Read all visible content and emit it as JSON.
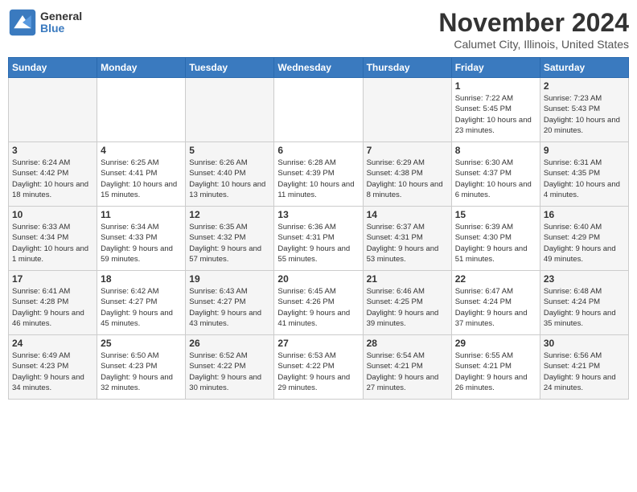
{
  "header": {
    "logo_general": "General",
    "logo_blue": "Blue",
    "month": "November 2024",
    "location": "Calumet City, Illinois, United States"
  },
  "days_of_week": [
    "Sunday",
    "Monday",
    "Tuesday",
    "Wednesday",
    "Thursday",
    "Friday",
    "Saturday"
  ],
  "weeks": [
    [
      {
        "day": "",
        "info": ""
      },
      {
        "day": "",
        "info": ""
      },
      {
        "day": "",
        "info": ""
      },
      {
        "day": "",
        "info": ""
      },
      {
        "day": "",
        "info": ""
      },
      {
        "day": "1",
        "info": "Sunrise: 7:22 AM\nSunset: 5:45 PM\nDaylight: 10 hours and 23 minutes."
      },
      {
        "day": "2",
        "info": "Sunrise: 7:23 AM\nSunset: 5:43 PM\nDaylight: 10 hours and 20 minutes."
      }
    ],
    [
      {
        "day": "3",
        "info": "Sunrise: 6:24 AM\nSunset: 4:42 PM\nDaylight: 10 hours and 18 minutes."
      },
      {
        "day": "4",
        "info": "Sunrise: 6:25 AM\nSunset: 4:41 PM\nDaylight: 10 hours and 15 minutes."
      },
      {
        "day": "5",
        "info": "Sunrise: 6:26 AM\nSunset: 4:40 PM\nDaylight: 10 hours and 13 minutes."
      },
      {
        "day": "6",
        "info": "Sunrise: 6:28 AM\nSunset: 4:39 PM\nDaylight: 10 hours and 11 minutes."
      },
      {
        "day": "7",
        "info": "Sunrise: 6:29 AM\nSunset: 4:38 PM\nDaylight: 10 hours and 8 minutes."
      },
      {
        "day": "8",
        "info": "Sunrise: 6:30 AM\nSunset: 4:37 PM\nDaylight: 10 hours and 6 minutes."
      },
      {
        "day": "9",
        "info": "Sunrise: 6:31 AM\nSunset: 4:35 PM\nDaylight: 10 hours and 4 minutes."
      }
    ],
    [
      {
        "day": "10",
        "info": "Sunrise: 6:33 AM\nSunset: 4:34 PM\nDaylight: 10 hours and 1 minute."
      },
      {
        "day": "11",
        "info": "Sunrise: 6:34 AM\nSunset: 4:33 PM\nDaylight: 9 hours and 59 minutes."
      },
      {
        "day": "12",
        "info": "Sunrise: 6:35 AM\nSunset: 4:32 PM\nDaylight: 9 hours and 57 minutes."
      },
      {
        "day": "13",
        "info": "Sunrise: 6:36 AM\nSunset: 4:31 PM\nDaylight: 9 hours and 55 minutes."
      },
      {
        "day": "14",
        "info": "Sunrise: 6:37 AM\nSunset: 4:31 PM\nDaylight: 9 hours and 53 minutes."
      },
      {
        "day": "15",
        "info": "Sunrise: 6:39 AM\nSunset: 4:30 PM\nDaylight: 9 hours and 51 minutes."
      },
      {
        "day": "16",
        "info": "Sunrise: 6:40 AM\nSunset: 4:29 PM\nDaylight: 9 hours and 49 minutes."
      }
    ],
    [
      {
        "day": "17",
        "info": "Sunrise: 6:41 AM\nSunset: 4:28 PM\nDaylight: 9 hours and 46 minutes."
      },
      {
        "day": "18",
        "info": "Sunrise: 6:42 AM\nSunset: 4:27 PM\nDaylight: 9 hours and 45 minutes."
      },
      {
        "day": "19",
        "info": "Sunrise: 6:43 AM\nSunset: 4:27 PM\nDaylight: 9 hours and 43 minutes."
      },
      {
        "day": "20",
        "info": "Sunrise: 6:45 AM\nSunset: 4:26 PM\nDaylight: 9 hours and 41 minutes."
      },
      {
        "day": "21",
        "info": "Sunrise: 6:46 AM\nSunset: 4:25 PM\nDaylight: 9 hours and 39 minutes."
      },
      {
        "day": "22",
        "info": "Sunrise: 6:47 AM\nSunset: 4:24 PM\nDaylight: 9 hours and 37 minutes."
      },
      {
        "day": "23",
        "info": "Sunrise: 6:48 AM\nSunset: 4:24 PM\nDaylight: 9 hours and 35 minutes."
      }
    ],
    [
      {
        "day": "24",
        "info": "Sunrise: 6:49 AM\nSunset: 4:23 PM\nDaylight: 9 hours and 34 minutes."
      },
      {
        "day": "25",
        "info": "Sunrise: 6:50 AM\nSunset: 4:23 PM\nDaylight: 9 hours and 32 minutes."
      },
      {
        "day": "26",
        "info": "Sunrise: 6:52 AM\nSunset: 4:22 PM\nDaylight: 9 hours and 30 minutes."
      },
      {
        "day": "27",
        "info": "Sunrise: 6:53 AM\nSunset: 4:22 PM\nDaylight: 9 hours and 29 minutes."
      },
      {
        "day": "28",
        "info": "Sunrise: 6:54 AM\nSunset: 4:21 PM\nDaylight: 9 hours and 27 minutes."
      },
      {
        "day": "29",
        "info": "Sunrise: 6:55 AM\nSunset: 4:21 PM\nDaylight: 9 hours and 26 minutes."
      },
      {
        "day": "30",
        "info": "Sunrise: 6:56 AM\nSunset: 4:21 PM\nDaylight: 9 hours and 24 minutes."
      }
    ]
  ]
}
